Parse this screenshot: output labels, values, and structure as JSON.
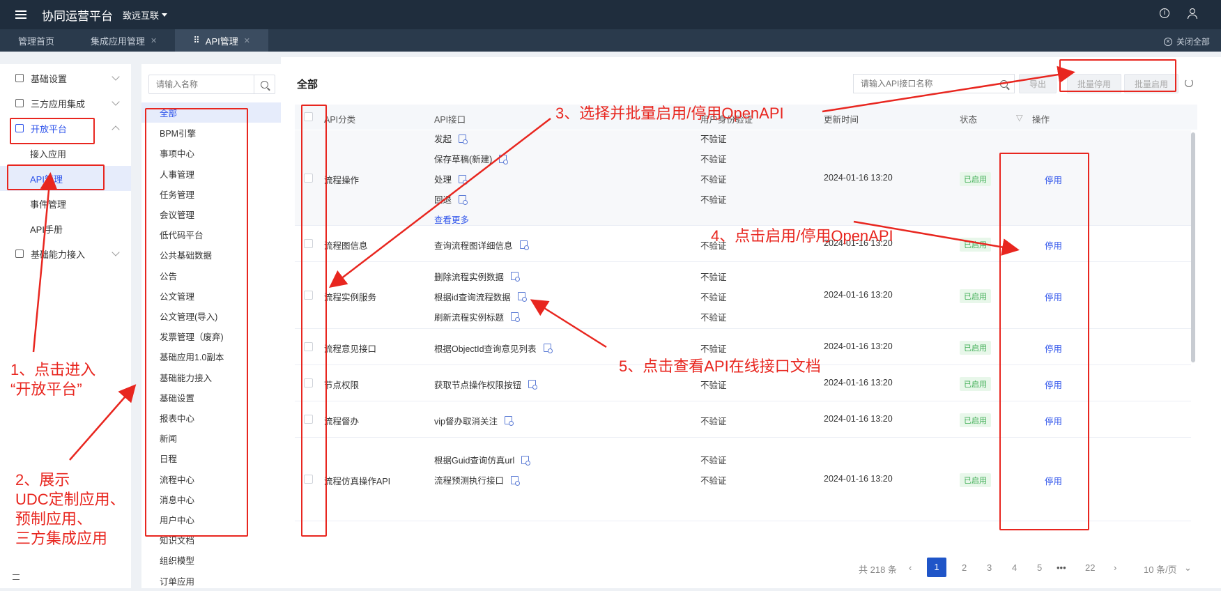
{
  "header": {
    "app_title": "协同运营平台",
    "org_name": "致远互联"
  },
  "tabs": [
    {
      "label": "管理首页"
    },
    {
      "label": "集成应用管理"
    },
    {
      "label": "API管理"
    }
  ],
  "close_all_label": "关闭全部",
  "sidebar": {
    "items": [
      {
        "label": "基础设置"
      },
      {
        "label": "三方应用集成"
      },
      {
        "label": "开放平台"
      },
      {
        "label": "基础能力接入"
      }
    ],
    "sub_items": [
      {
        "label": "接入应用"
      },
      {
        "label": "API管理"
      },
      {
        "label": "事件管理"
      },
      {
        "label": "API手册"
      }
    ]
  },
  "category_panel": {
    "search_placeholder": "请输入名称",
    "items": [
      "全部",
      "BPM引擎",
      "事项中心",
      "人事管理",
      "任务管理",
      "会议管理",
      "低代码平台",
      "公共基础数据",
      "公告",
      "公文管理",
      "公文管理(导入)",
      "发票管理（废弃)",
      "基础应用1.0副本",
      "基础能力接入",
      "基础设置",
      "报表中心",
      "新闻",
      "日程",
      "流程中心",
      "消息中心",
      "用户中心",
      "知识文档",
      "组织模型",
      "订单应用"
    ]
  },
  "main": {
    "title": "全部",
    "search_placeholder": "请输入API接口名称",
    "export_label": "导出",
    "batch_disable_label": "批量停用",
    "batch_enable_label": "批量启用",
    "columns": {
      "category": "API分类",
      "api": "API接口",
      "auth": "用户身份验证",
      "updated": "更新时间",
      "status": "状态",
      "action": "操作"
    },
    "rows": [
      {
        "category": "流程操作",
        "apis": [
          "发起",
          "保存草稿(新建)",
          "处理",
          "回退"
        ],
        "more": "查看更多",
        "auth": [
          "不验证",
          "不验证",
          "不验证",
          "不验证"
        ],
        "updated": "2024-01-16 13:20",
        "status": "已启用",
        "action": "停用"
      },
      {
        "category": "流程图信息",
        "apis": [
          "查询流程图详细信息"
        ],
        "auth": [
          "不验证"
        ],
        "updated": "2024-01-16 13:20",
        "status": "已启用",
        "action": "停用"
      },
      {
        "category": "流程实例服务",
        "apis": [
          "删除流程实例数据",
          "根据id查询流程数据",
          "刷新流程实例标题"
        ],
        "auth": [
          "不验证",
          "不验证",
          "不验证"
        ],
        "updated": "2024-01-16 13:20",
        "status": "已启用",
        "action": "停用"
      },
      {
        "category": "流程意见接口",
        "apis": [
          "根据ObjectId查询意见列表"
        ],
        "auth": [
          "不验证"
        ],
        "updated": "2024-01-16 13:20",
        "status": "已启用",
        "action": "停用"
      },
      {
        "category": "节点权限",
        "apis": [
          "获取节点操作权限按钮"
        ],
        "auth": [
          "不验证"
        ],
        "updated": "2024-01-16 13:20",
        "status": "已启用",
        "action": "停用"
      },
      {
        "category": "流程督办",
        "apis": [
          "vip督办取消关注"
        ],
        "auth": [
          "不验证"
        ],
        "updated": "2024-01-16 13:20",
        "status": "已启用",
        "action": "停用"
      },
      {
        "category": "流程仿真操作API",
        "apis": [
          "根据Guid查询仿真url",
          "流程预测执行接口"
        ],
        "auth": [
          "不验证",
          "不验证"
        ],
        "updated": "2024-01-16 13:20",
        "status": "已启用",
        "action": "停用"
      }
    ]
  },
  "pagination": {
    "total": "共 218 条",
    "pages": [
      "1",
      "2",
      "3",
      "4",
      "5",
      "•••",
      "22"
    ],
    "page_size": "10 条/页"
  },
  "annotations": {
    "step1": "1、点击进入\n“开放平台”",
    "step2": "2、展示\nUDC定制应用、\n预制应用、\n三方集成应用",
    "step3": "3、选择并批量启用/停用OpenAPI",
    "step4": "4、点击启用/停用OpenAPI",
    "step5": "5、点击查看API在线接口文档",
    "color": "#e8261f"
  }
}
